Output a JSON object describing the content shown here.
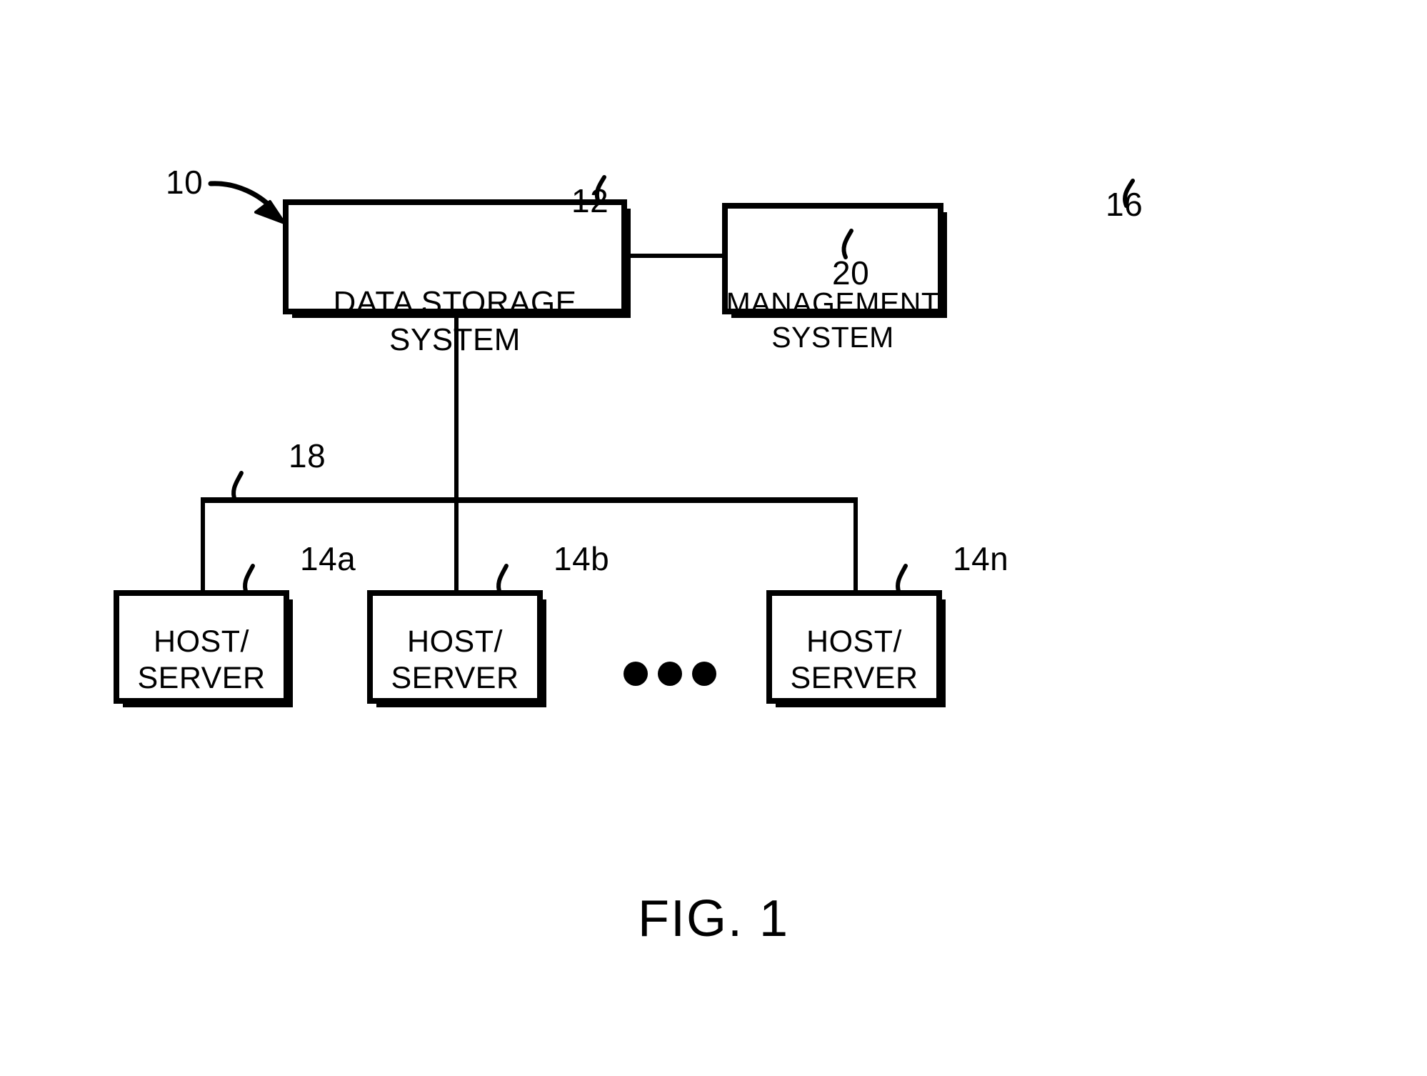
{
  "figure": {
    "caption": "FIG. 1",
    "reference_numerals": {
      "system": "10",
      "data_storage_system": "12",
      "hosts": [
        "14a",
        "14b",
        "14n"
      ],
      "management_system": "16",
      "communication_medium": "18",
      "management_link": "20"
    }
  },
  "blocks": {
    "data_storage_system": {
      "label": "DATA STORAGE\nSYSTEM",
      "ref": "12"
    },
    "management_system": {
      "label": "MANAGEMENT\nSYSTEM",
      "ref": "16"
    },
    "host_a": {
      "label": "HOST/\nSERVER",
      "ref": "14a"
    },
    "host_b": {
      "label": "HOST/\nSERVER",
      "ref": "14b"
    },
    "host_n": {
      "label": "HOST/\nSERVER",
      "ref": "14n"
    }
  },
  "connectors": {
    "storage_to_management": {
      "ref": "20"
    },
    "host_bus": {
      "ref": "18"
    }
  },
  "ellipsis": {
    "label": "• • •",
    "dot_count": 3
  },
  "colors": {
    "ink": "#000000",
    "paper": "#ffffff"
  }
}
